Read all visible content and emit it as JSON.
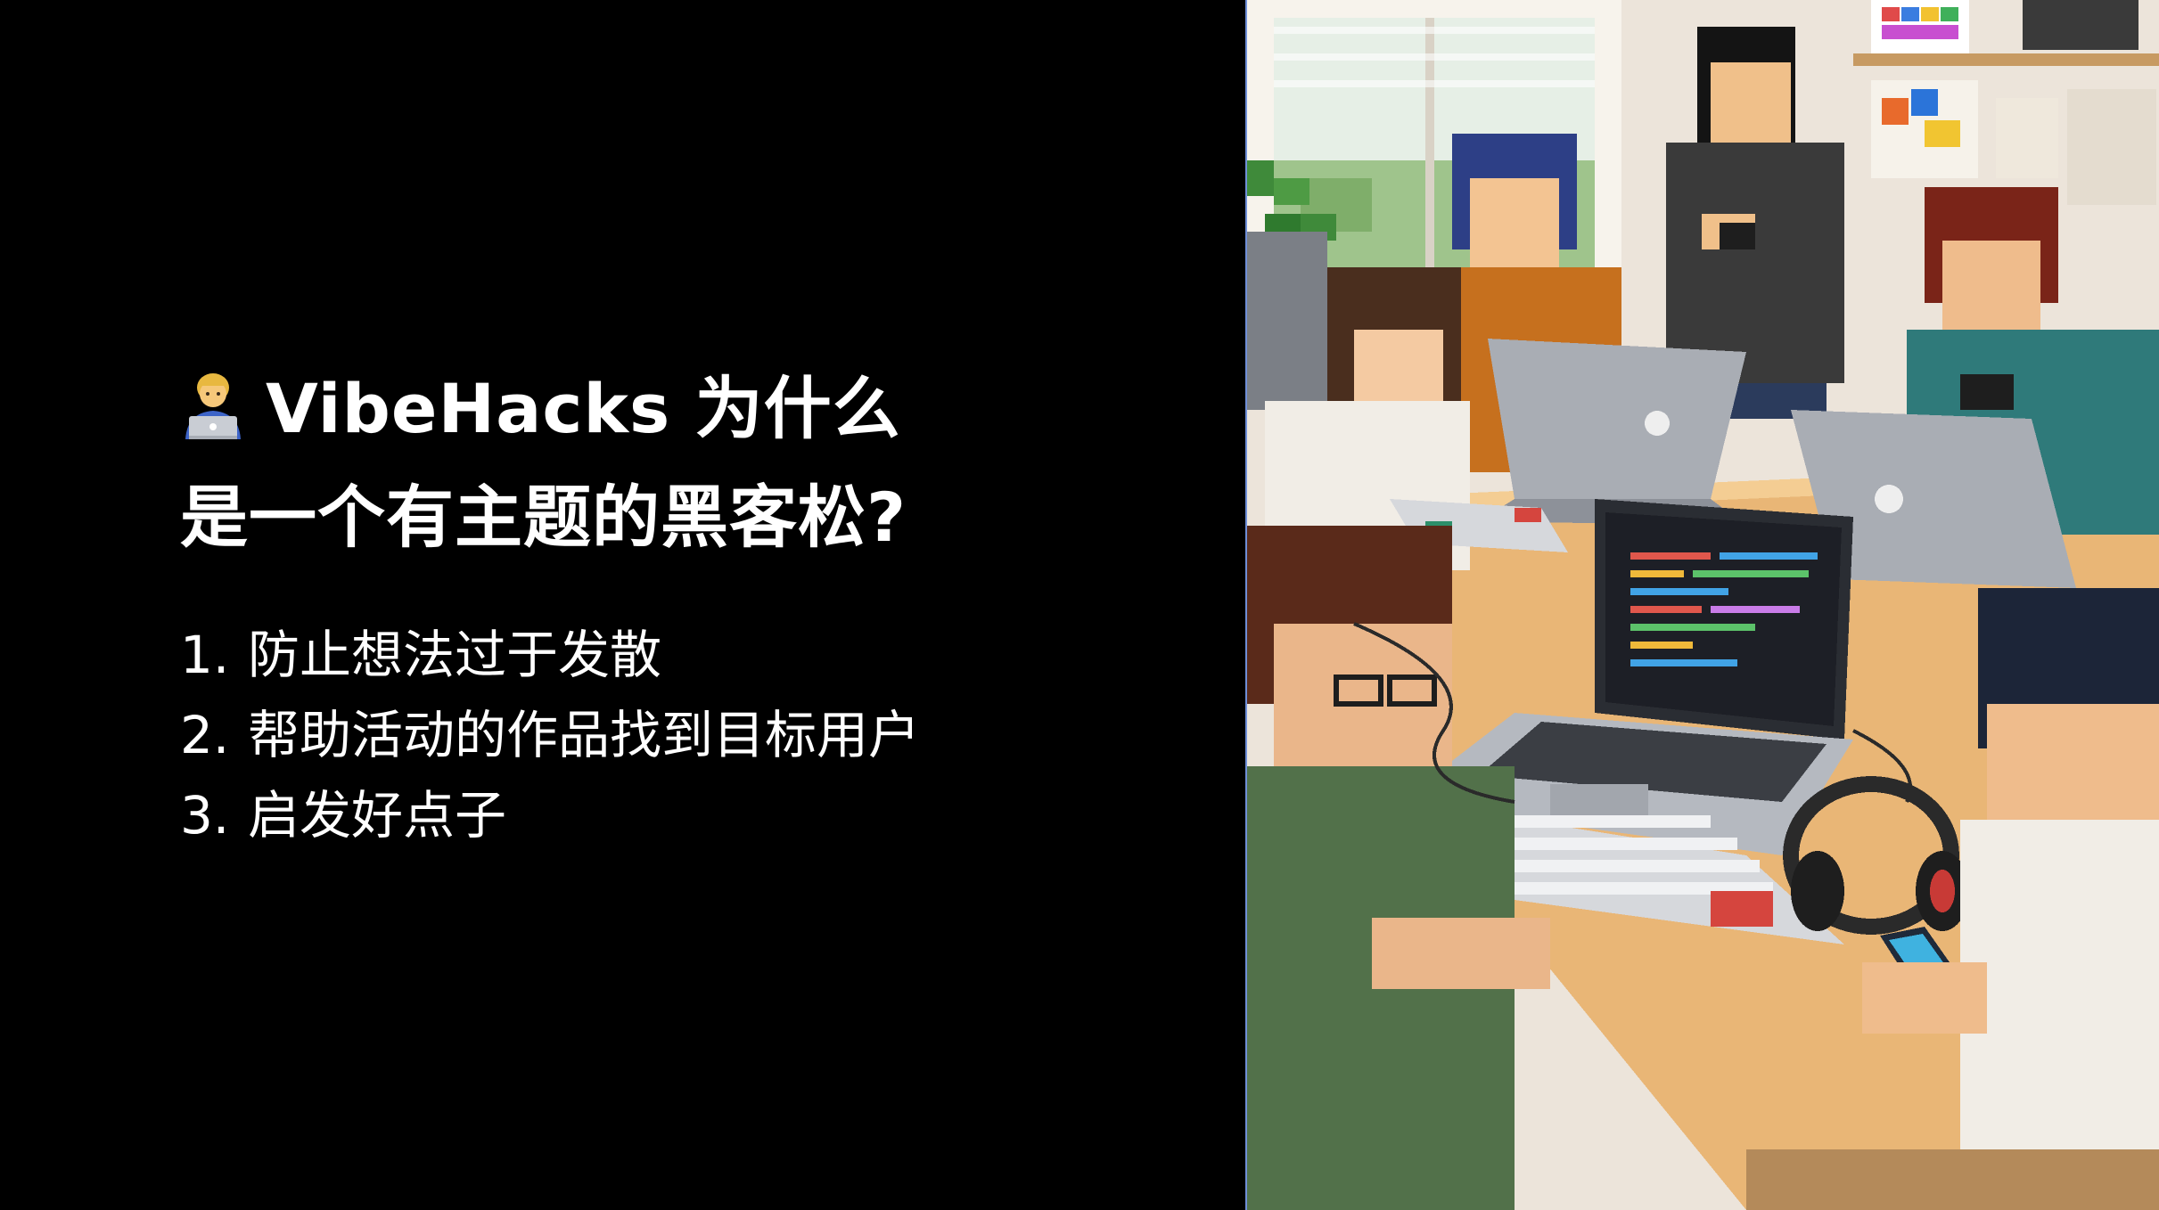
{
  "slide": {
    "title_line1": "VibeHacks 为什么",
    "title_line2": "是一个有主题的黑客松?",
    "title_icon": "technologist-emoji-icon",
    "reasons": [
      {
        "num": "1.",
        "text": "防止想法过于发散"
      },
      {
        "num": "2.",
        "text": "帮助活动的作品找到目标用户"
      },
      {
        "num": "3.",
        "text": "启发好点子"
      }
    ]
  },
  "illustration": {
    "subject": "pixel-art-hackathon-team-illustration"
  }
}
